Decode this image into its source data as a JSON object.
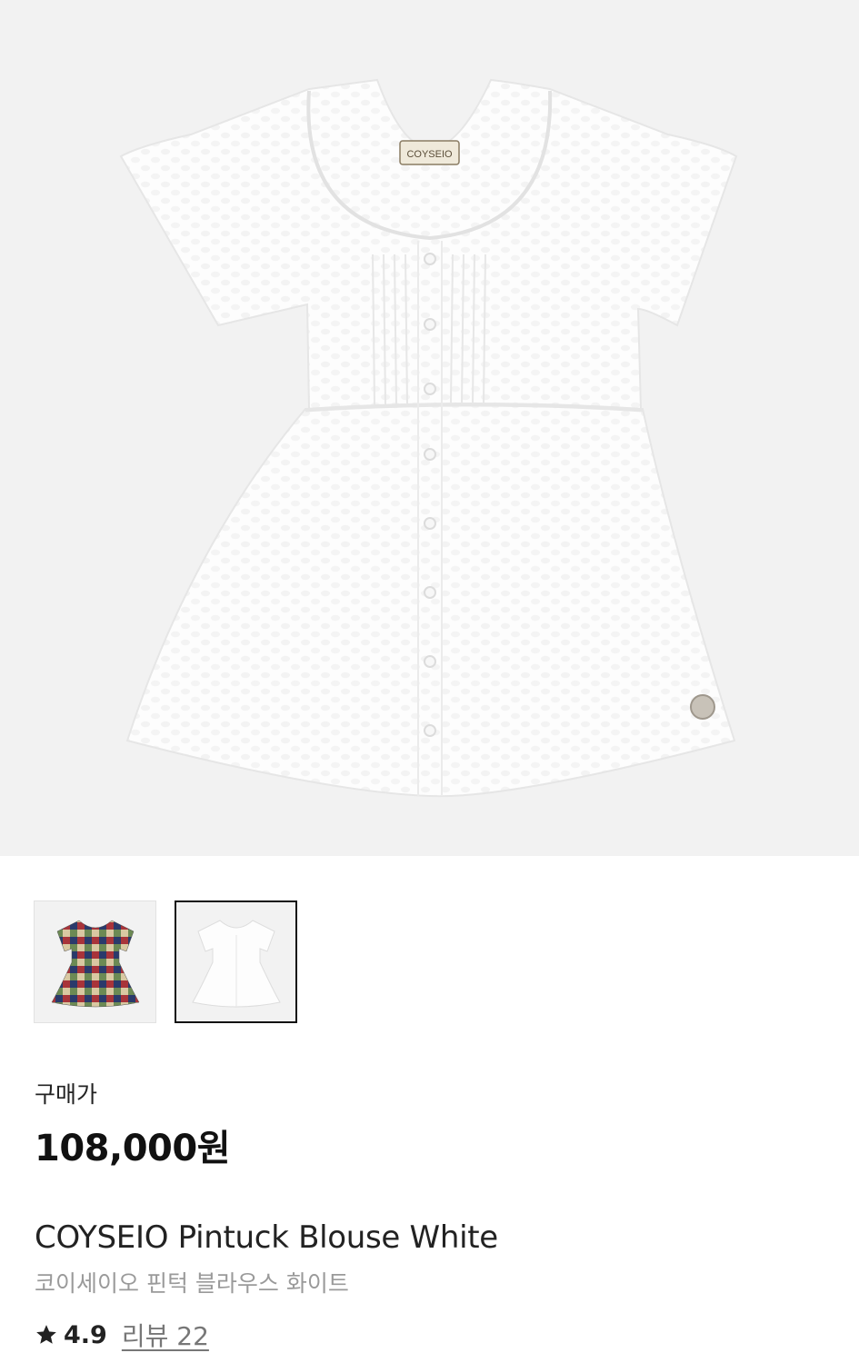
{
  "product": {
    "brand_tag": "COYSEIO",
    "price_label": "구매가",
    "price": "108,000원",
    "name_en": "COYSEIO Pintuck Blouse White",
    "name_kr": "코이세이오 핀턱 블라우스 화이트",
    "rating": "4.9",
    "review_link": "리뷰 22"
  },
  "thumbnails": [
    {
      "name": "checkered-multicolor",
      "selected": false
    },
    {
      "name": "white",
      "selected": true
    }
  ],
  "icons": {
    "rating": "star-icon"
  },
  "colors": {
    "hero_bg": "#f2f2f2",
    "price_text": "#111111",
    "subtitle_text": "#9a9a9a",
    "review_link": "#777777",
    "thumb_selected_border": "#111111"
  }
}
